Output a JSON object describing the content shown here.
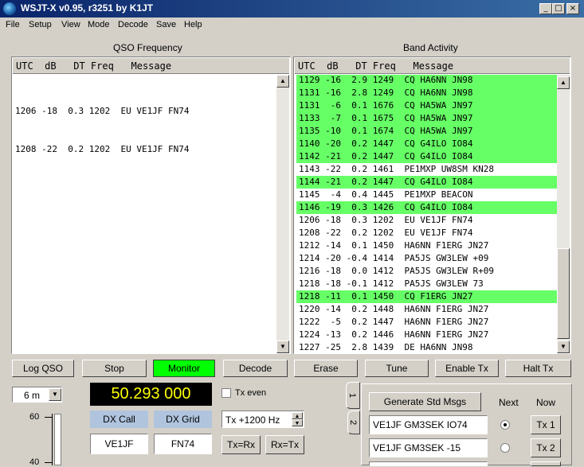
{
  "window": {
    "title": "WSJT-X  v0.95, r3251   by K1JT",
    "min": "_",
    "max": "□",
    "close": "×"
  },
  "menu": [
    "File",
    "Setup",
    "View",
    "Mode",
    "Decode",
    "Save",
    "Help"
  ],
  "qso": {
    "title": "QSO Frequency",
    "columns": "UTC  dB   DT Freq   Message",
    "rows": [
      "1206 -18  0.3 1202  EU VE1JF FN74",
      "1208 -22  0.2 1202  EU VE1JF FN74"
    ]
  },
  "band": {
    "title": "Band Activity",
    "columns": "UTC  dB   DT Freq   Message",
    "rows": [
      {
        "text": "1129 -16  2.9 1249  CQ HA6NN JN98",
        "hl": true
      },
      {
        "text": "1131 -16  2.8 1249  CQ HA6NN JN98",
        "hl": true
      },
      {
        "text": "1131  -6  0.1 1676  CQ HA5WA JN97",
        "hl": true
      },
      {
        "text": "1133  -7  0.1 1675  CQ HA5WA JN97",
        "hl": true
      },
      {
        "text": "1135 -10  0.1 1674  CQ HA5WA JN97",
        "hl": true
      },
      {
        "text": "1140 -20  0.2 1447  CQ G4ILO IO84",
        "hl": true
      },
      {
        "text": "1142 -21  0.2 1447  CQ G4ILO IO84",
        "hl": true
      },
      {
        "text": "1143 -22  0.2 1461  PE1MXP UW8SM KN28",
        "hl": false
      },
      {
        "text": "1144 -21  0.2 1447  CQ G4ILO IO84",
        "hl": true
      },
      {
        "text": "1145  -4  0.4 1445  PE1MXP BEACON",
        "hl": false
      },
      {
        "text": "1146 -19  0.3 1426  CQ G4ILO IO84",
        "hl": true
      },
      {
        "text": "1206 -18  0.3 1202  EU VE1JF FN74",
        "hl": false
      },
      {
        "text": "1208 -22  0.2 1202  EU VE1JF FN74",
        "hl": false
      },
      {
        "text": "1212 -14  0.1 1450  HA6NN F1ERG JN27",
        "hl": false
      },
      {
        "text": "1214 -20 -0.4 1414  PA5JS GW3LEW +09",
        "hl": false
      },
      {
        "text": "1216 -18  0.0 1412  PA5JS GW3LEW R+09",
        "hl": false
      },
      {
        "text": "1218 -18 -0.1 1412  PA5JS GW3LEW 73",
        "hl": false
      },
      {
        "text": "1218 -11  0.1 1450  CQ F1ERG JN27",
        "hl": true
      },
      {
        "text": "1220 -14  0.2 1448  HA6NN F1ERG JN27",
        "hl": false
      },
      {
        "text": "1222  -5  0.2 1447  HA6NN F1ERG JN27",
        "hl": false
      },
      {
        "text": "1224 -13  0.2 1446  HA6NN F1ERG JN27",
        "hl": false
      },
      {
        "text": "1227 -25  2.8 1439  DE HA6NN JN98",
        "hl": false
      }
    ]
  },
  "buttons": [
    "Log QSO",
    "Stop",
    "Monitor",
    "Decode",
    "Erase",
    "Tune",
    "Enable Tx",
    "Halt Tx"
  ],
  "band_select": "6 m",
  "frequency": "50.293 000",
  "tx_even": "Tx even",
  "dx_call_label": "DX Call",
  "dx_grid_label": "DX Grid",
  "dx_call": "VE1JF",
  "dx_grid": "FN74",
  "tx_offset": "Tx +1200  Hz",
  "tx_eq_rx": "Tx=Rx",
  "rx_eq_tx": "Rx=Tx",
  "meter_ticks": [
    "60",
    "40"
  ],
  "tabs": [
    "1",
    "2"
  ],
  "generate_std": "Generate Std Msgs",
  "next_label": "Next",
  "now_label": "Now",
  "messages": [
    {
      "text": "VE1JF GM3SEK IO74",
      "btn": "Tx 1",
      "selected": true
    },
    {
      "text": "VE1JF GM3SEK -15",
      "btn": "Tx 2",
      "selected": false
    }
  ],
  "colors": {
    "highlight": "#66ff66",
    "monitor": "#00ff00",
    "freq_bg": "#000000",
    "freq_fg": "#ffff00",
    "dx_label_bg": "#b0c4de"
  }
}
